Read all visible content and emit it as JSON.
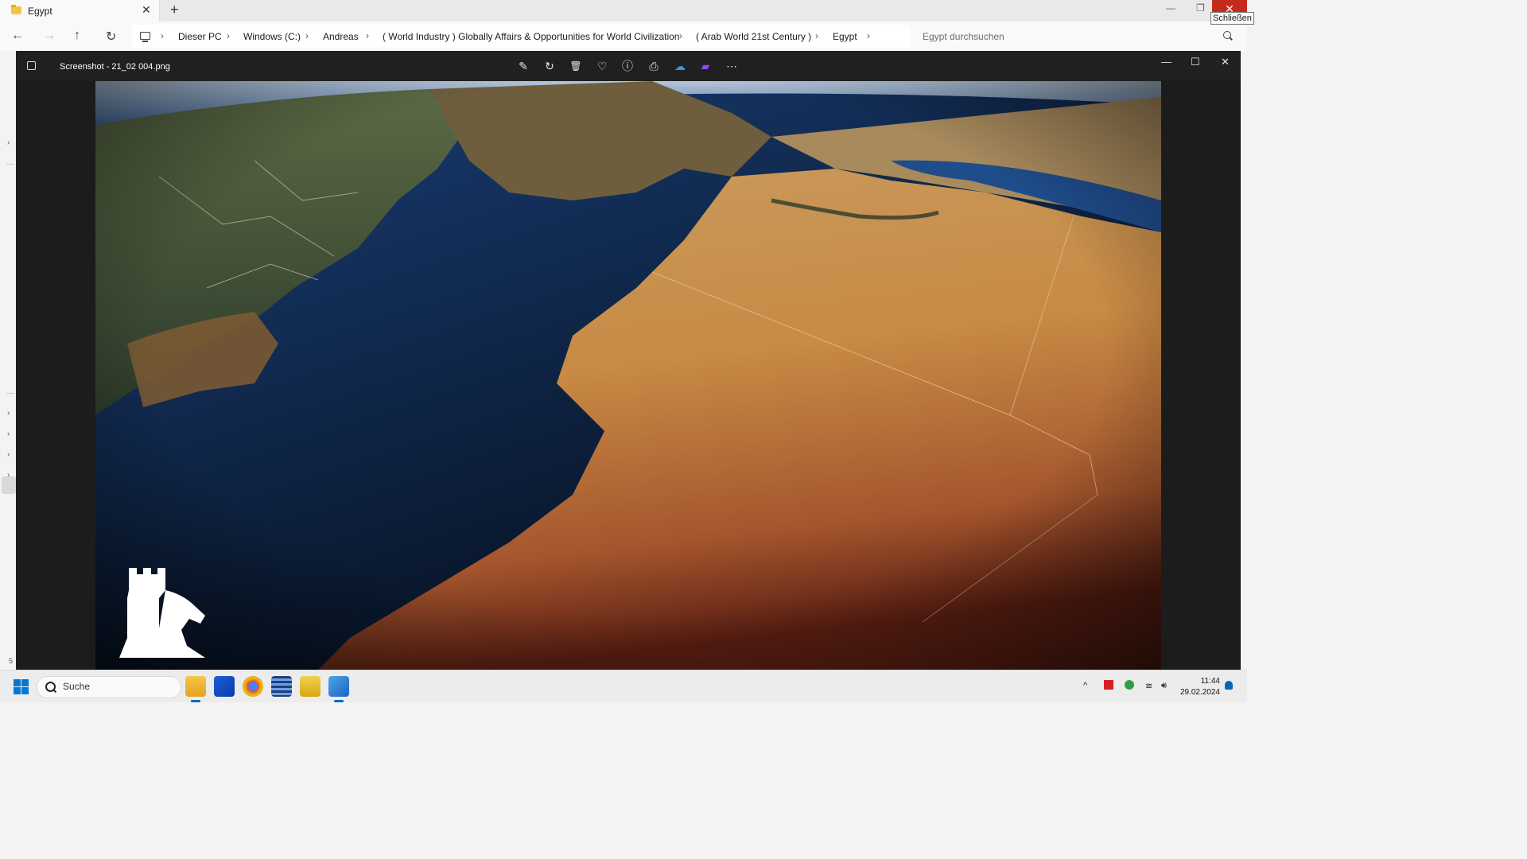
{
  "explorer": {
    "tab_title": "Egypt",
    "new_tab_symbol": "+",
    "close_tooltip": "Schließen",
    "breadcrumbs": [
      "Dieser PC",
      "Windows (C:)",
      "Andreas",
      "( World Industry ) Globally Affairs & Opportunities for World Civilization",
      "( Arab World 21st Century )",
      "Egypt"
    ],
    "search_placeholder": "Egypt durchsuchen",
    "left_pane_number": "5"
  },
  "viewer": {
    "file_name": "Screenshot - 21_02 004.png",
    "toolbar": [
      {
        "name": "edit-image-icon",
        "glyph": "✎"
      },
      {
        "name": "rotate-icon",
        "glyph": "↻"
      },
      {
        "name": "delete-icon",
        "glyph": "🗑"
      },
      {
        "name": "favorite-icon",
        "glyph": "♡"
      },
      {
        "name": "file-info-icon",
        "glyph": "ⓘ"
      },
      {
        "name": "print-icon",
        "glyph": "⎙"
      },
      {
        "name": "onedrive-icon",
        "glyph": "☁"
      },
      {
        "name": "clipchamp-icon",
        "glyph": "▰"
      },
      {
        "name": "more-options-icon",
        "glyph": "⋯"
      }
    ]
  },
  "taskbar": {
    "search_placeholder": "Suche",
    "time": "11:44",
    "date": "29.02.2024"
  },
  "colors": {
    "close_red": "#c42b1c",
    "accent_blue": "#0067c0",
    "viewer_bg": "#202020"
  }
}
